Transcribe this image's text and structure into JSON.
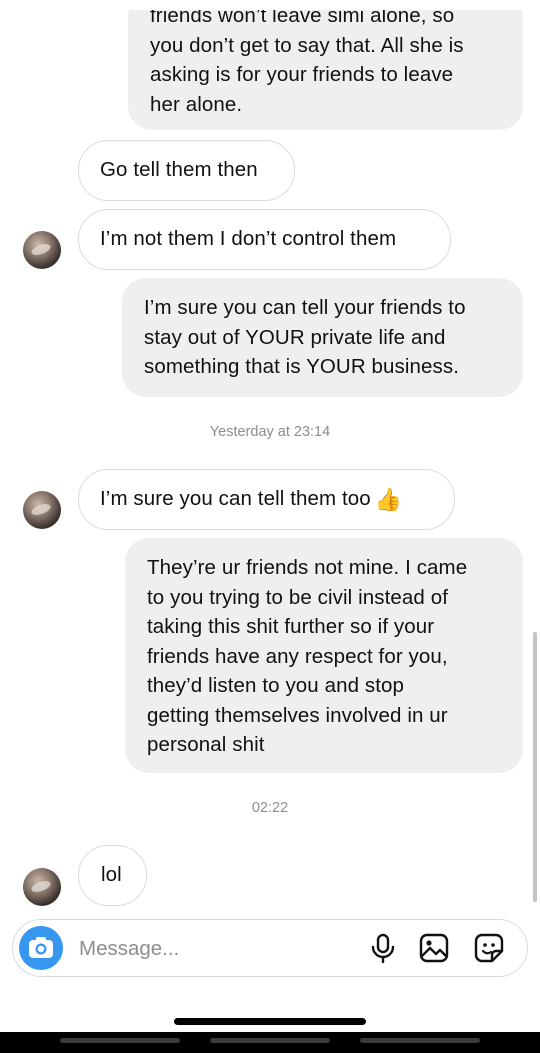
{
  "messages": [
    {
      "side": "outgoing",
      "text": "friends won’t leave simi alone, so\nyou don’t get to say that. All she is\nasking is for your friends to leave\nher alone."
    },
    {
      "side": "incoming",
      "text": "Go tell them then"
    },
    {
      "side": "incoming",
      "text": "I’m not them I don’t control them"
    },
    {
      "side": "outgoing",
      "text": "I’m sure you can tell your friends to\nstay out of YOUR private life and\nsomething that is YOUR business."
    },
    {
      "side": "incoming",
      "text": "I’m sure you can tell them too",
      "emoji": "👍"
    },
    {
      "side": "outgoing",
      "text": "They’re ur friends not mine. I came\nto you trying to be civil instead of\ntaking this shit further so if your\nfriends have any respect for you,\nthey’d listen to you and stop\ngetting themselves involved in ur\npersonal shit"
    },
    {
      "side": "incoming",
      "text": "lol"
    }
  ],
  "timestamps": [
    "Yesterday at 23:14",
    "02:22"
  ],
  "composer": {
    "placeholder": "Message...",
    "icons": [
      "camera-icon",
      "microphone-icon",
      "gallery-icon",
      "sticker-icon"
    ],
    "accent": "#3797f0"
  }
}
